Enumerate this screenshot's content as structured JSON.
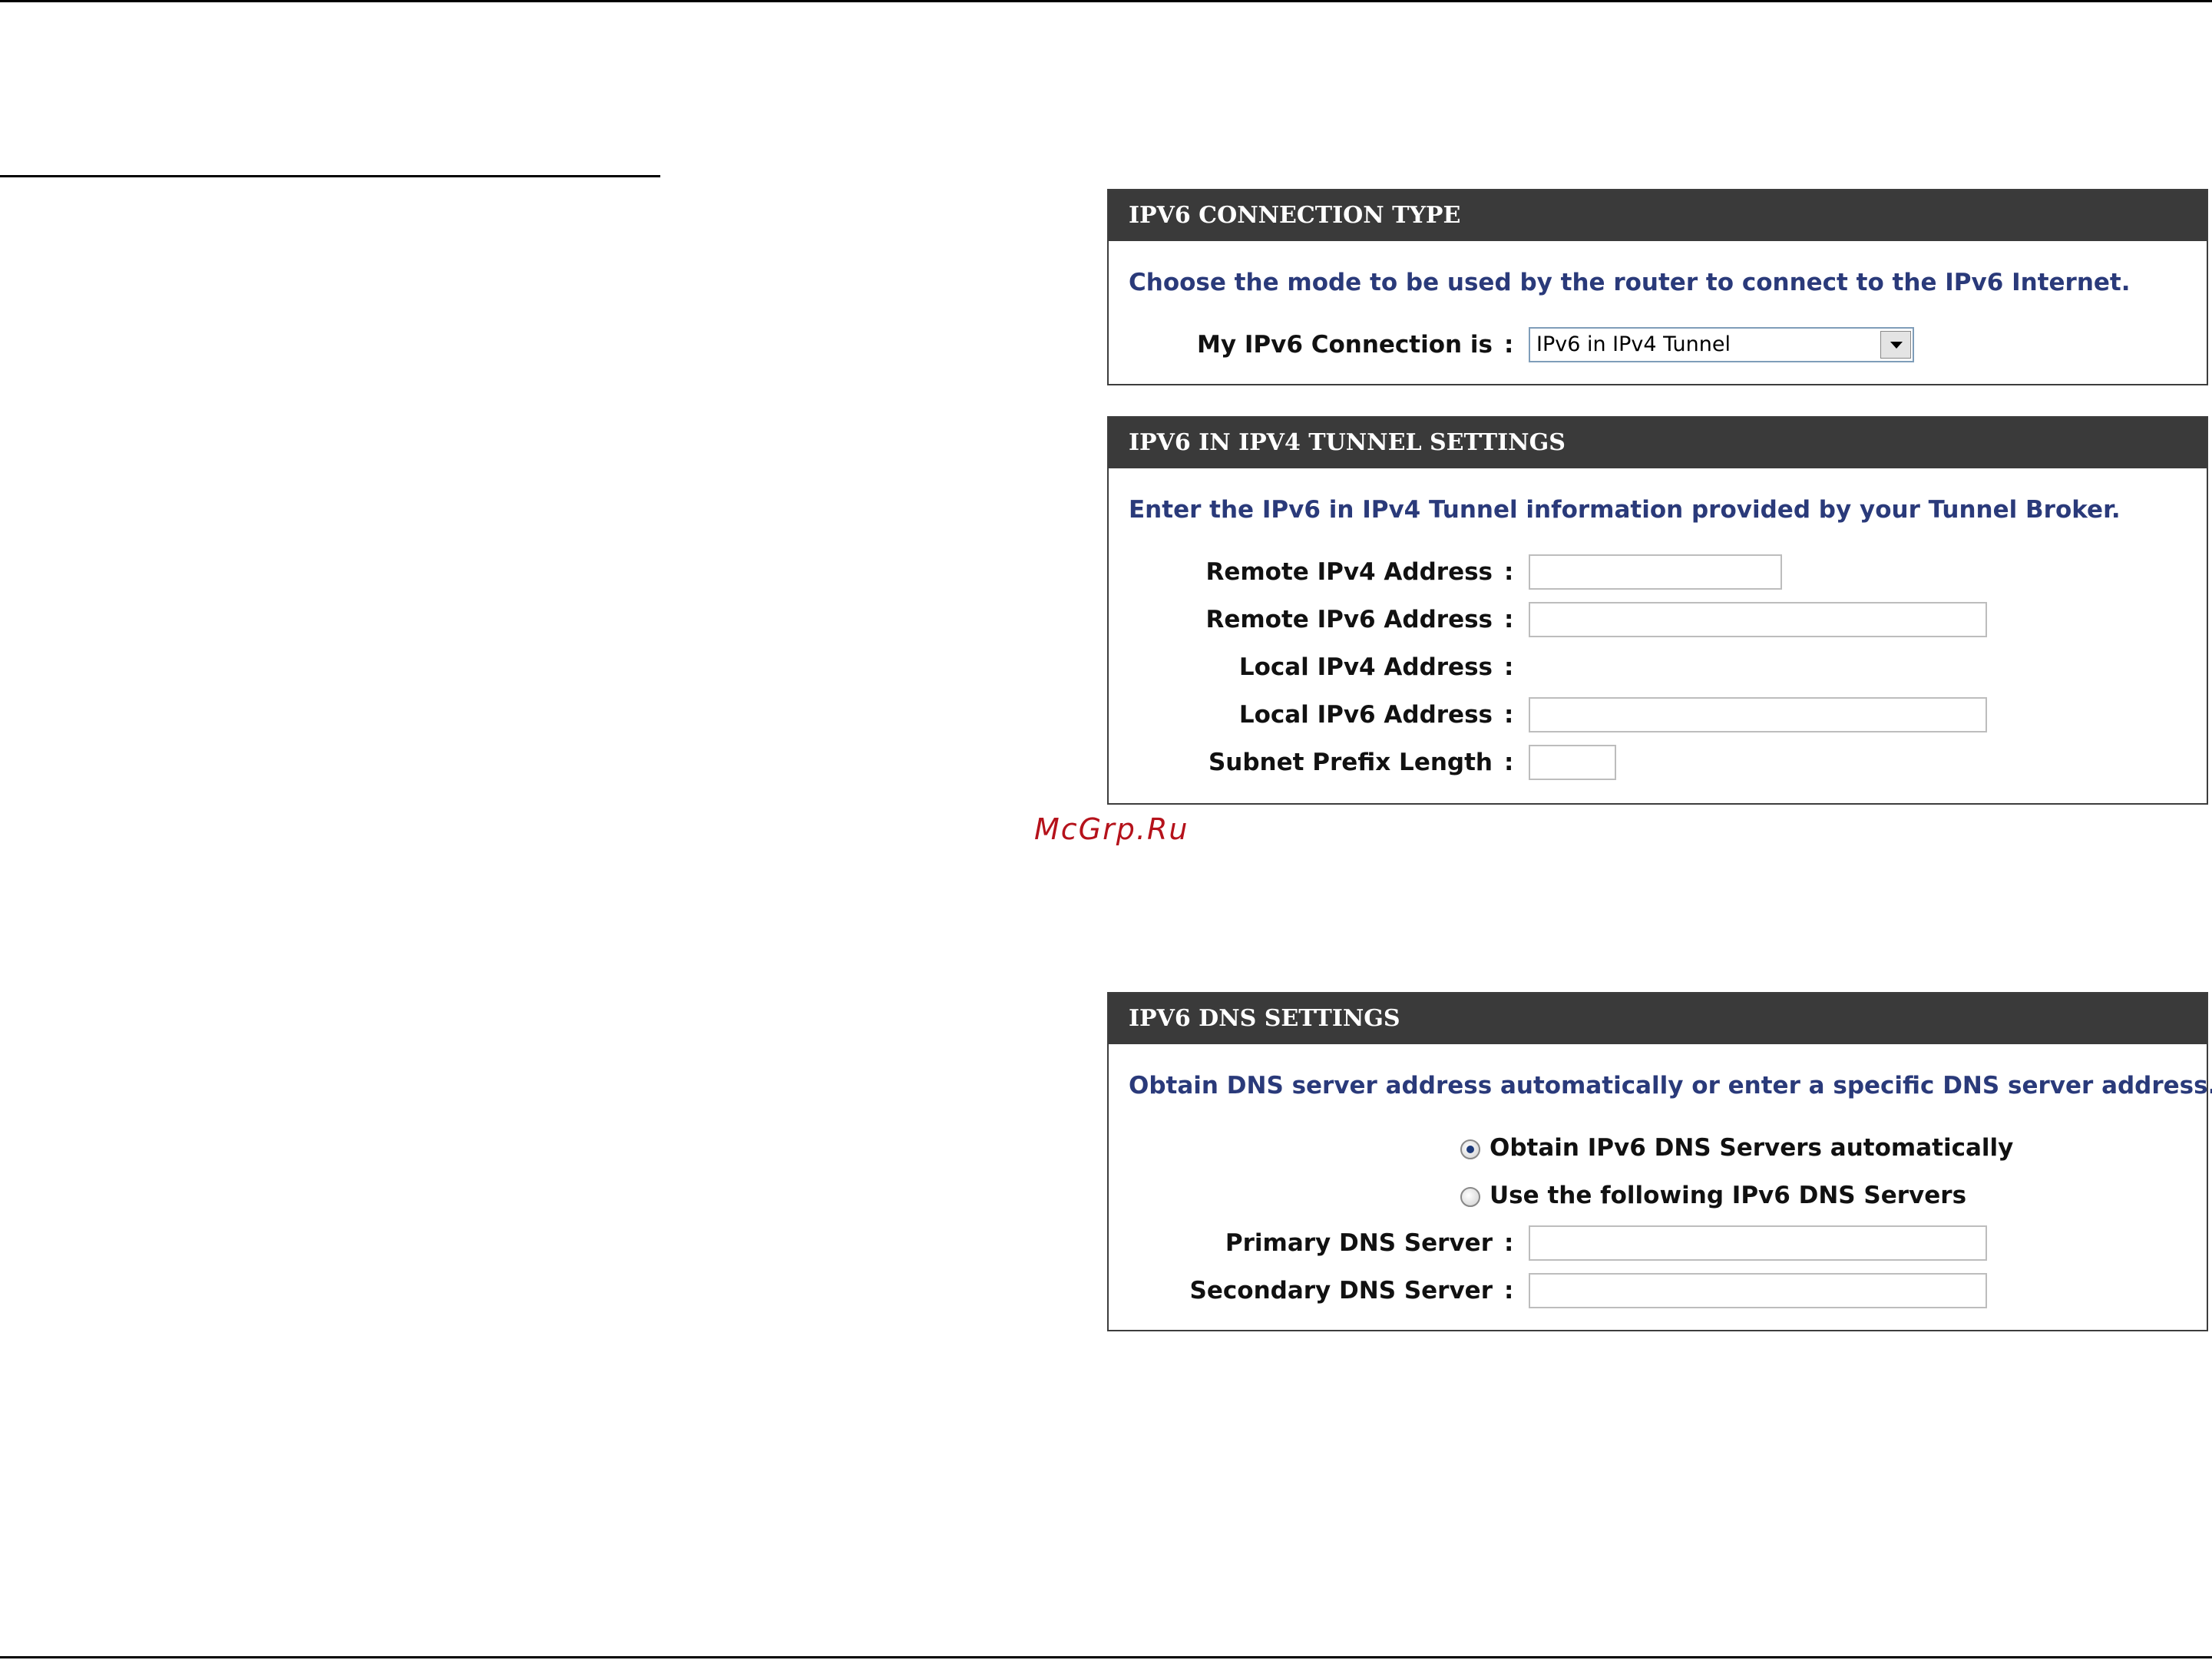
{
  "watermark": "McGrp.Ru",
  "connection_type": {
    "header": "IPV6 CONNECTION TYPE",
    "description": "Choose the mode to be used by the router to connect to the IPv6 Internet.",
    "connection_label": "My IPv6 Connection is",
    "connection_value": "IPv6 in IPv4 Tunnel"
  },
  "tunnel_settings": {
    "header": "IPV6 IN IPV4 TUNNEL SETTINGS",
    "description": "Enter the IPv6 in IPv4 Tunnel information provided by your Tunnel Broker.",
    "remote_ipv4_label": "Remote IPv4 Address",
    "remote_ipv4_value": "",
    "remote_ipv6_label": "Remote IPv6 Address",
    "remote_ipv6_value": "",
    "local_ipv4_label": "Local IPv4 Address",
    "local_ipv6_label": "Local IPv6 Address",
    "local_ipv6_value": "",
    "subnet_prefix_label": "Subnet Prefix Length",
    "subnet_prefix_value": ""
  },
  "dns_settings": {
    "header": "IPV6 DNS SETTINGS",
    "description": "Obtain DNS server address automatically or enter a specific DNS server address.",
    "radio_auto_label": "Obtain IPv6 DNS Servers automatically",
    "radio_auto_checked": true,
    "radio_manual_label": "Use the following IPv6 DNS Servers",
    "radio_manual_checked": false,
    "primary_label": "Primary DNS Server",
    "primary_value": "",
    "secondary_label": "Secondary DNS Server",
    "secondary_value": ""
  },
  "colon": ":"
}
